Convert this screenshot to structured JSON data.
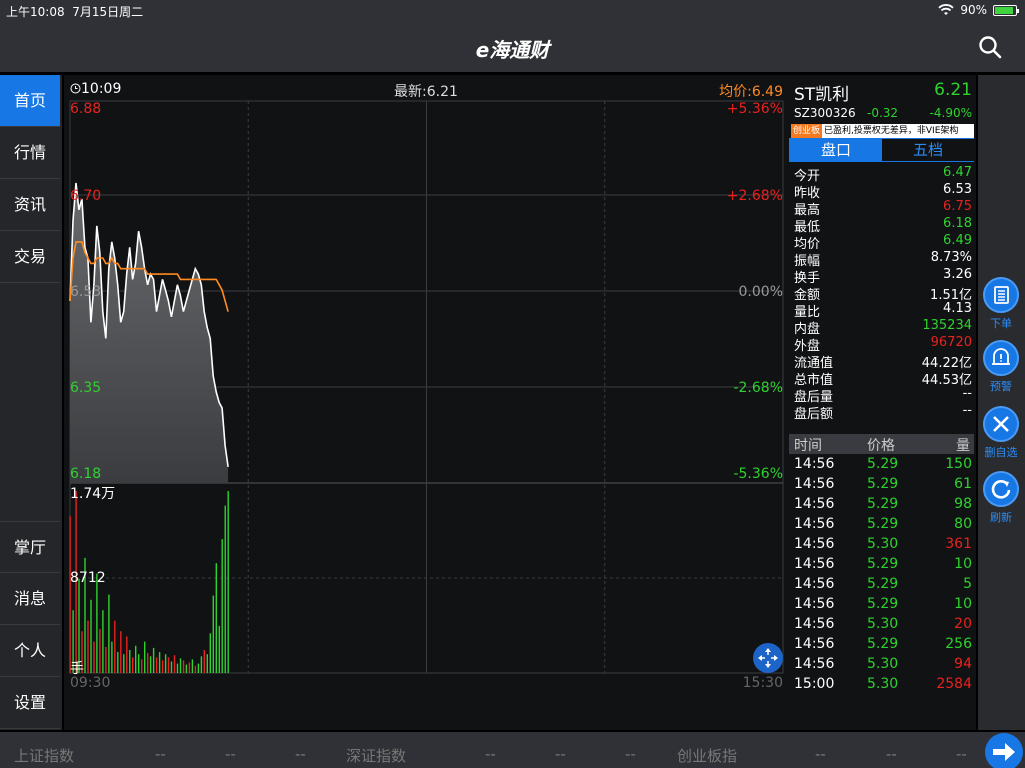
{
  "status": {
    "time": "上午10:08",
    "date": "7月15日周二",
    "wifi": "wifi-icon",
    "battery": "90%",
    "battery_fraction": 0.9
  },
  "nav": {
    "title": "e海通财",
    "search_icon": "search-icon"
  },
  "sidebar": {
    "items": [
      {
        "label": "首页",
        "active": true
      },
      {
        "label": "行情",
        "active": false
      },
      {
        "label": "资讯",
        "active": false
      },
      {
        "label": "交易",
        "active": false
      },
      {
        "label": "掌厅",
        "active": false
      },
      {
        "label": "消息",
        "active": false
      },
      {
        "label": "个人",
        "active": false
      },
      {
        "label": "设置",
        "active": false
      }
    ]
  },
  "chart_header": {
    "time": "10:09",
    "latest": "最新:6.21",
    "avg": "均价:6.49"
  },
  "chart_data": {
    "type": "line",
    "price_ticks": [
      "6.88",
      "6.70",
      "6.53",
      "6.35",
      "6.18"
    ],
    "price_values": [
      6.88,
      6.7,
      6.53,
      6.35,
      6.18
    ],
    "pct_ticks": [
      "+5.36%",
      "+2.68%",
      "0.00%",
      "-2.68%",
      "-5.36%"
    ],
    "volume_ticks": [
      "1.74万",
      "8712",
      "手"
    ],
    "x_ticks": [
      "09:30",
      "15:30"
    ],
    "ylim": [
      6.18,
      6.88
    ],
    "series": [
      {
        "name": "最新",
        "color": "#ffffff",
        "values": [
          6.52,
          6.67,
          6.74,
          6.69,
          6.71,
          6.62,
          6.6,
          6.48,
          6.55,
          6.66,
          6.61,
          6.5,
          6.45,
          6.58,
          6.63,
          6.6,
          6.55,
          6.48,
          6.5,
          6.57,
          6.62,
          6.56,
          6.59,
          6.65,
          6.62,
          6.58,
          6.55,
          6.57,
          6.56,
          6.5,
          6.53,
          6.56,
          6.54,
          6.52,
          6.49,
          6.52,
          6.55,
          6.53,
          6.5,
          6.52,
          6.54,
          6.56,
          6.58,
          6.57,
          6.55,
          6.5,
          6.47,
          6.45,
          6.38,
          6.35,
          6.33,
          6.32,
          6.25,
          6.21
        ]
      },
      {
        "name": "均价",
        "color": "#ff8a22",
        "values": [
          6.52,
          6.6,
          6.63,
          6.63,
          6.63,
          6.61,
          6.6,
          6.59,
          6.59,
          6.6,
          6.6,
          6.6,
          6.59,
          6.59,
          6.6,
          6.59,
          6.59,
          6.58,
          6.58,
          6.58,
          6.58,
          6.58,
          6.58,
          6.58,
          6.58,
          6.58,
          6.57,
          6.57,
          6.57,
          6.57,
          6.57,
          6.57,
          6.57,
          6.57,
          6.57,
          6.57,
          6.57,
          6.56,
          6.56,
          6.56,
          6.56,
          6.56,
          6.56,
          6.56,
          6.56,
          6.56,
          6.56,
          6.56,
          6.56,
          6.56,
          6.55,
          6.54,
          6.52,
          6.5
        ]
      }
    ],
    "volume": [
      {
        "v": 15000,
        "c": "r"
      },
      {
        "v": 6000,
        "c": "g"
      },
      {
        "v": 17400,
        "c": "r"
      },
      {
        "v": 9000,
        "c": "g"
      },
      {
        "v": 4000,
        "c": "r"
      },
      {
        "v": 11000,
        "c": "g"
      },
      {
        "v": 5000,
        "c": "r"
      },
      {
        "v": 7000,
        "c": "g"
      },
      {
        "v": 3000,
        "c": "r"
      },
      {
        "v": 9500,
        "c": "g"
      },
      {
        "v": 4200,
        "c": "r"
      },
      {
        "v": 6000,
        "c": "g"
      },
      {
        "v": 2500,
        "c": "r"
      },
      {
        "v": 7500,
        "c": "g"
      },
      {
        "v": 3000,
        "c": "g"
      },
      {
        "v": 5000,
        "c": "r"
      },
      {
        "v": 2000,
        "c": "g"
      },
      {
        "v": 4000,
        "c": "r"
      },
      {
        "v": 1800,
        "c": "g"
      },
      {
        "v": 3500,
        "c": "r"
      },
      {
        "v": 2200,
        "c": "g"
      },
      {
        "v": 1500,
        "c": "r"
      },
      {
        "v": 2600,
        "c": "g"
      },
      {
        "v": 1800,
        "c": "g"
      },
      {
        "v": 1300,
        "c": "r"
      },
      {
        "v": 3000,
        "c": "g"
      },
      {
        "v": 1900,
        "c": "r"
      },
      {
        "v": 1600,
        "c": "g"
      },
      {
        "v": 2400,
        "c": "g"
      },
      {
        "v": 1500,
        "c": "r"
      },
      {
        "v": 2000,
        "c": "g"
      },
      {
        "v": 1200,
        "c": "r"
      },
      {
        "v": 1800,
        "c": "g"
      },
      {
        "v": 1500,
        "c": "r"
      },
      {
        "v": 1100,
        "c": "g"
      },
      {
        "v": 1700,
        "c": "r"
      },
      {
        "v": 900,
        "c": "g"
      },
      {
        "v": 1400,
        "c": "g"
      },
      {
        "v": 1200,
        "c": "r"
      },
      {
        "v": 800,
        "c": "g"
      },
      {
        "v": 1000,
        "c": "r"
      },
      {
        "v": 1300,
        "c": "g"
      },
      {
        "v": 700,
        "c": "r"
      },
      {
        "v": 900,
        "c": "g"
      },
      {
        "v": 1600,
        "c": "g"
      },
      {
        "v": 2200,
        "c": "r"
      },
      {
        "v": 1800,
        "c": "g"
      },
      {
        "v": 3800,
        "c": "g"
      },
      {
        "v": 7400,
        "c": "g"
      },
      {
        "v": 10500,
        "c": "g"
      },
      {
        "v": 4500,
        "c": "g"
      },
      {
        "v": 12800,
        "c": "g"
      },
      {
        "v": 16000,
        "c": "g"
      },
      {
        "v": 17400,
        "c": "g"
      }
    ],
    "volume_max": 17400,
    "slots": 240,
    "colors": {
      "up": "#e8231f",
      "down": "#2fd22f",
      "flat": "#9a9a9a",
      "grid": "#3b3c40"
    }
  },
  "quote": {
    "name": "ST凯利",
    "price": "6.21",
    "code": "SZ300326",
    "change": "-0.32",
    "pct": "-4.90%",
    "tag_board": "创业板",
    "tag_text": "已盈利,投票权无差异，非VIE架构",
    "tabs": [
      "盘口",
      "五档"
    ],
    "rows": [
      {
        "k": "今开",
        "v": "6.47",
        "c": "#2fd22f"
      },
      {
        "k": "昨收",
        "v": "6.53",
        "c": "#ffffff"
      },
      {
        "k": "最高",
        "v": "6.75",
        "c": "#e8231f"
      },
      {
        "k": "最低",
        "v": "6.18",
        "c": "#2fd22f"
      },
      {
        "k": "均价",
        "v": "6.49",
        "c": "#2fd22f"
      },
      {
        "k": "振幅",
        "v": "8.73%",
        "c": "#ffffff"
      },
      {
        "k": "换手",
        "v": "3.26",
        "c": "#ffffff"
      },
      {
        "k": "金额",
        "v": "1.51亿",
        "c": "#ffffff"
      },
      {
        "k": "量比",
        "v": "4.13",
        "c": "#ffffff"
      },
      {
        "k": "内盘",
        "v": "135234",
        "c": "#2fd22f"
      },
      {
        "k": "外盘",
        "v": "96720",
        "c": "#e8231f"
      },
      {
        "k": "流通值",
        "v": "44.22亿",
        "c": "#ffffff"
      },
      {
        "k": "总市值",
        "v": "44.53亿",
        "c": "#ffffff"
      },
      {
        "k": "盘后量",
        "v": "--",
        "c": "#ffffff"
      },
      {
        "k": "盘后额",
        "v": "--",
        "c": "#ffffff"
      }
    ],
    "ticks_head": [
      "时间",
      "价格",
      "量"
    ],
    "ticks": [
      {
        "t": "14:56",
        "p": "5.29",
        "v": "150",
        "vc": "#2fd22f"
      },
      {
        "t": "14:56",
        "p": "5.29",
        "v": "61",
        "vc": "#2fd22f"
      },
      {
        "t": "14:56",
        "p": "5.29",
        "v": "98",
        "vc": "#2fd22f"
      },
      {
        "t": "14:56",
        "p": "5.29",
        "v": "80",
        "vc": "#2fd22f"
      },
      {
        "t": "14:56",
        "p": "5.30",
        "v": "361",
        "vc": "#e8231f"
      },
      {
        "t": "14:56",
        "p": "5.29",
        "v": "10",
        "vc": "#2fd22f"
      },
      {
        "t": "14:56",
        "p": "5.29",
        "v": "5",
        "vc": "#2fd22f"
      },
      {
        "t": "14:56",
        "p": "5.29",
        "v": "10",
        "vc": "#2fd22f"
      },
      {
        "t": "14:56",
        "p": "5.30",
        "v": "20",
        "vc": "#e8231f"
      },
      {
        "t": "14:56",
        "p": "5.29",
        "v": "256",
        "vc": "#2fd22f"
      },
      {
        "t": "14:56",
        "p": "5.30",
        "v": "94",
        "vc": "#e8231f"
      },
      {
        "t": "15:00",
        "p": "5.30",
        "v": "2584",
        "vc": "#e8231f"
      }
    ]
  },
  "rightbar": {
    "buttons": [
      {
        "label": "下单",
        "icon": "order-icon"
      },
      {
        "label": "预警",
        "icon": "bell-icon"
      },
      {
        "label": "删自选",
        "icon": "close-icon"
      },
      {
        "label": "刷新",
        "icon": "refresh-icon"
      }
    ]
  },
  "bottom": {
    "sh_label": "上证指数",
    "sz_label": "深证指数",
    "cy_label": "创业板指",
    "dash": "--"
  }
}
